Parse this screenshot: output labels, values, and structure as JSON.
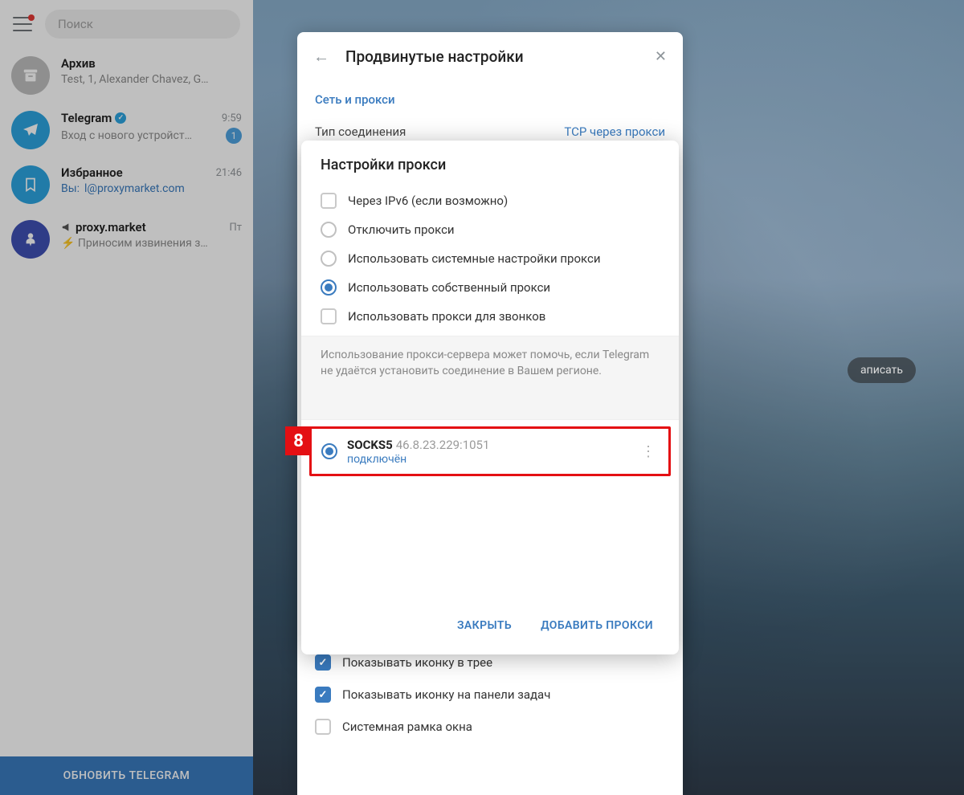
{
  "sidebar": {
    "search_placeholder": "Поиск",
    "update_label": "ОБНОВИТЬ TELEGRAM",
    "chats": [
      {
        "name": "Архив",
        "message": "Test, 1, Alexander Chavez, G…",
        "time": ""
      },
      {
        "name": "Telegram",
        "message": "Вход с нового устройст…",
        "time": "9:59",
        "badge": "1",
        "verified": true
      },
      {
        "name": "Избранное",
        "you_prefix": "Вы:",
        "message": "l@proxymarket.com",
        "time": "21:46"
      },
      {
        "name": "proxy.market",
        "message": "⚡ Приносим извинения з…",
        "time": "Пт",
        "channel": true
      }
    ]
  },
  "advanced": {
    "title": "Продвинутые настройки",
    "section_net": "Сеть и прокси",
    "conn_type_label": "Тип соединения",
    "conn_type_value": "TCP через прокси",
    "opts": [
      {
        "label": "Показывать иконку в трее",
        "checked": true
      },
      {
        "label": "Показывать иконку на панели задач",
        "checked": true
      },
      {
        "label": "Системная рамка окна",
        "checked": false
      }
    ]
  },
  "proxy": {
    "title": "Настройки прокси",
    "step": "8",
    "options": [
      {
        "type": "cb",
        "label": "Через IPv6 (если возможно)"
      },
      {
        "type": "rb",
        "label": "Отключить прокси"
      },
      {
        "type": "rb",
        "label": "Использовать системные настройки прокси"
      },
      {
        "type": "rb",
        "label": "Использовать собственный прокси",
        "selected": true
      },
      {
        "type": "cb",
        "label": "Использовать прокси для звонков"
      }
    ],
    "help": "Использование прокси-сервера может помочь, если Telegram не удаётся установить соединение в Вашем регионе.",
    "entry": {
      "protocol": "SOCKS5",
      "address": "46.8.23.229:1051",
      "status": "подключён"
    },
    "close_label": "ЗАКРЫТЬ",
    "add_label": "ДОБАВИТЬ ПРОКСИ"
  },
  "write_label": "аписать"
}
